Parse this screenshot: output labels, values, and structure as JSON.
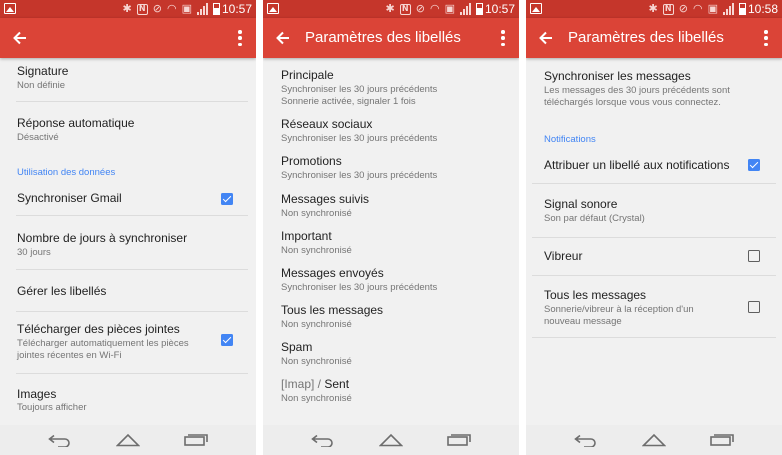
{
  "status": {
    "times": [
      "10:57",
      "10:57",
      "10:58"
    ],
    "nfc_letter": "N"
  },
  "screen1": {
    "items": [
      {
        "title": "Signature",
        "subtitle": "Non définie"
      },
      {
        "title": "Réponse automatique",
        "subtitle": "Désactivé"
      }
    ],
    "section_label": "Utilisation des données",
    "sync_gmail": {
      "title": "Synchroniser Gmail",
      "checked": true
    },
    "days_to_sync": {
      "title": "Nombre de jours à synchroniser",
      "subtitle": "30 jours"
    },
    "manage_labels": {
      "title": "Gérer les libellés"
    },
    "download_attachments": {
      "title": "Télécharger des pièces jointes",
      "subtitle_line1": "Télécharger automatiquement les pièces",
      "subtitle_line2": "jointes récentes en Wi-Fi",
      "checked": true
    },
    "images": {
      "title": "Images",
      "subtitle": "Toujours afficher"
    }
  },
  "screen2": {
    "title": "Paramètres des libellés",
    "labels": [
      {
        "name": "Principale",
        "sub1": "Synchroniser les 30 jours précédents",
        "sub2": "Sonnerie activée, signaler 1 fois"
      },
      {
        "name": "Réseaux sociaux",
        "sub1": "Synchroniser les 30 jours précédents"
      },
      {
        "name": "Promotions",
        "sub1": "Synchroniser les 30 jours précédents"
      },
      {
        "name": "Messages suivis",
        "sub1": "Non synchronisé"
      },
      {
        "name": "Important",
        "sub1": "Non synchronisé"
      },
      {
        "name": "Messages envoyés",
        "sub1": "Synchroniser les 30 jours précédents"
      },
      {
        "name": "Tous les messages",
        "sub1": "Non synchronisé"
      },
      {
        "name": "Spam",
        "sub1": "Non synchronisé"
      }
    ],
    "imap_prefix": "[Imap] / ",
    "imap_name": "Sent",
    "imap_sub": "Non synchronisé"
  },
  "screen3": {
    "title": "Paramètres des libellés",
    "sync_messages": {
      "title": "Synchroniser les messages",
      "sub1": "Les messages des 30 jours précédents sont",
      "sub2": "téléchargés lorsque vous vous connectez."
    },
    "section_label": "Notifications",
    "label_notifications": {
      "title": "Attribuer un libellé aux notifications",
      "checked": true
    },
    "ringtone": {
      "title": "Signal sonore",
      "subtitle": "Son par défaut (Crystal)"
    },
    "vibrate": {
      "title": "Vibreur",
      "checked": false
    },
    "all_messages": {
      "title": "Tous les messages",
      "sub1": "Sonnerie/vibreur à la réception d'un",
      "sub2": "nouveau message",
      "checked": false
    }
  },
  "colors": {
    "appbar": "#db4437",
    "statusbar": "#c5362b",
    "accent": "#4285f4"
  },
  "icons": [
    "back-arrow-icon",
    "more-vert-icon",
    "checkbox-icon",
    "nav-back-icon",
    "nav-home-icon",
    "nav-recent-icon"
  ]
}
